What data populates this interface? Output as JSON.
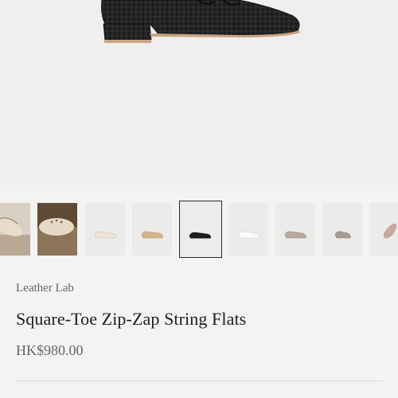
{
  "product": {
    "brand": "Leather Lab",
    "title": "Square-Toe Zip-Zap String Flats",
    "price": "HK$980.00"
  },
  "gallery": {
    "selected_index": 4,
    "thumbnails": [
      {
        "name": "thumb-lifestyle-1",
        "color": "#c9b8a0"
      },
      {
        "name": "thumb-lifestyle-2",
        "color": "#b8a082"
      },
      {
        "name": "thumb-cream",
        "color": "#ede4d2"
      },
      {
        "name": "thumb-tan",
        "color": "#d8b48e"
      },
      {
        "name": "thumb-black",
        "color": "#1c1c1c"
      },
      {
        "name": "thumb-white",
        "color": "#f6f6f6"
      },
      {
        "name": "thumb-taupe",
        "color": "#b8a99a"
      },
      {
        "name": "thumb-grey-beige",
        "color": "#a49a92"
      },
      {
        "name": "thumb-blush",
        "color": "#c8aaa2"
      }
    ]
  }
}
